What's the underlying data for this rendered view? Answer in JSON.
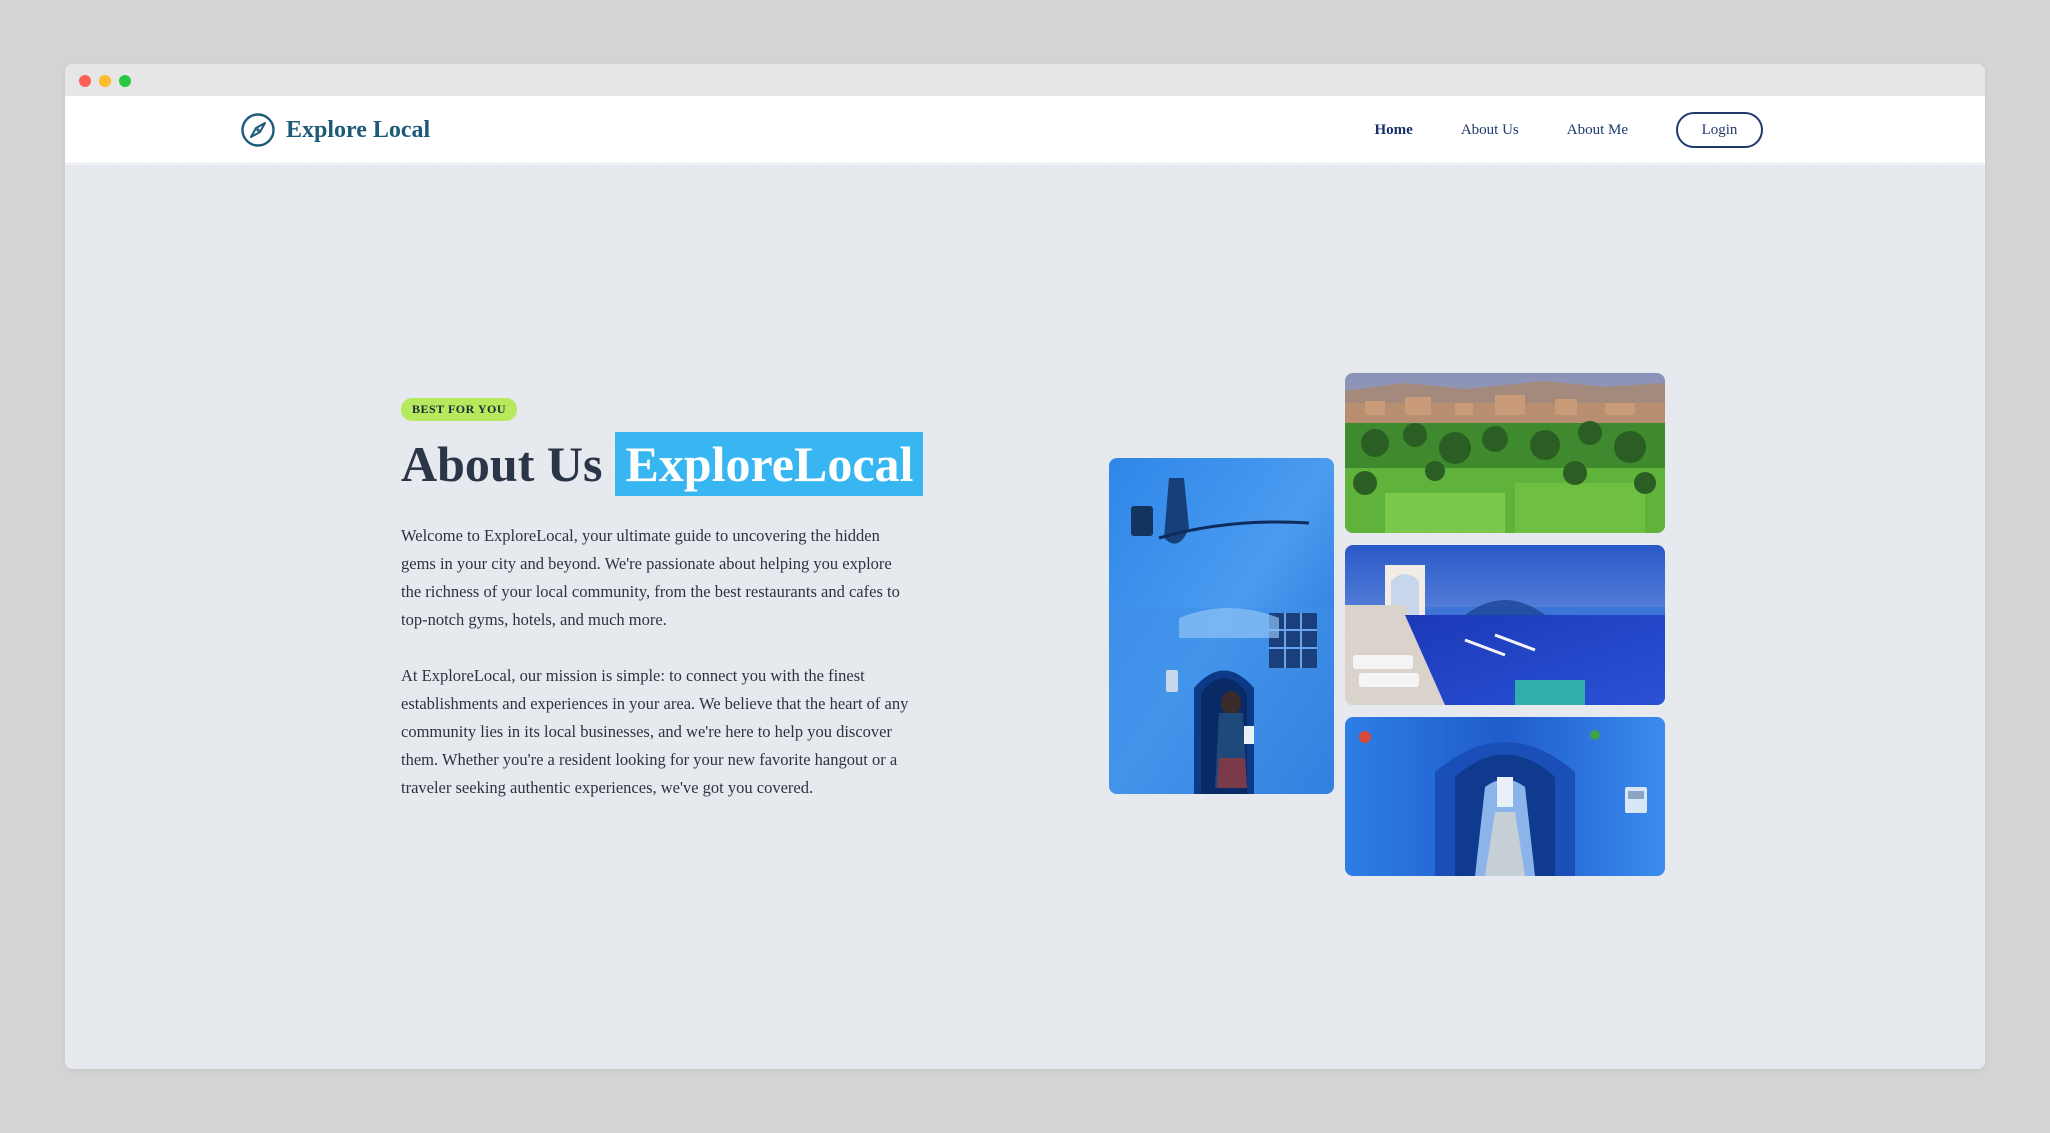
{
  "brand": {
    "name": "Explore Local",
    "icon": "compass-icon"
  },
  "nav": {
    "items": [
      {
        "label": "Home",
        "active": true
      },
      {
        "label": "About Us",
        "active": false
      },
      {
        "label": "About Me",
        "active": false
      }
    ],
    "login_label": "Login"
  },
  "hero": {
    "badge": "BEST FOR YOU",
    "title_plain": "About Us",
    "title_highlight": "ExploreLocal",
    "paragraphs": [
      "Welcome to ExploreLocal, your ultimate guide to uncovering the hidden gems in your city and beyond. We're passionate about helping you explore the richness of your local community, from the best restaurants and cafes to top-notch gyms, hotels, and much more.",
      "At ExploreLocal, our mission is simple: to connect you with the finest establishments and experiences in your area. We believe that the heart of any community lies in its local businesses, and we're here to help you discover them. Whether you're a resident looking for your new favorite hangout or a traveler seeking authentic experiences, we've got you covered."
    ]
  },
  "colors": {
    "brand": "#1d5a7a",
    "nav_text": "#1e3a6d",
    "badge_bg": "#b6ea5c",
    "highlight_bg": "#38b6f2",
    "heading": "#2b3548"
  }
}
